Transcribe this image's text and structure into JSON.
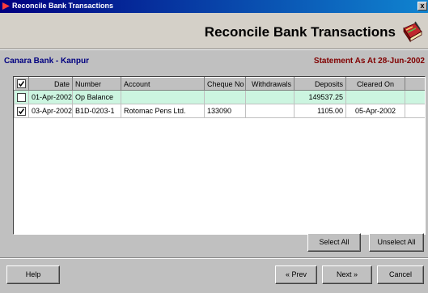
{
  "window": {
    "title": "Reconcile Bank Transactions",
    "close_label": "x"
  },
  "header": {
    "heading": "Reconcile Bank Transactions",
    "icon": "ledger-book-icon"
  },
  "bank_label": "Canara Bank - Kanpur",
  "statement_label": "Statement As At 28-Jun-2002",
  "table": {
    "columns": [
      "Date",
      "Number",
      "Account",
      "Cheque No",
      "Withdrawals",
      "Deposits",
      "Cleared On"
    ],
    "rows": [
      {
        "checked": false,
        "date": "01-Apr-2002",
        "number": "Op Balance",
        "account": "",
        "cheque_no": "",
        "withdrawals": "",
        "deposits": "149537.25",
        "cleared_on": ""
      },
      {
        "checked": true,
        "date": "03-Apr-2002",
        "number": "B1D-0203-1",
        "account": "Rotomac Pens Ltd.",
        "cheque_no": "133090",
        "withdrawals": "",
        "deposits": "1105.00",
        "cleared_on": "05-Apr-2002"
      }
    ]
  },
  "buttons": {
    "select_all": "Select All",
    "unselect_all": "Unselect All",
    "help": "Help",
    "prev": "« Prev",
    "next": "Next »",
    "cancel": "Cancel"
  },
  "colors": {
    "title_bar": "#000080",
    "bank_label": "#000080",
    "statement_label": "#800000",
    "selected_row": "#ccf5e0"
  }
}
